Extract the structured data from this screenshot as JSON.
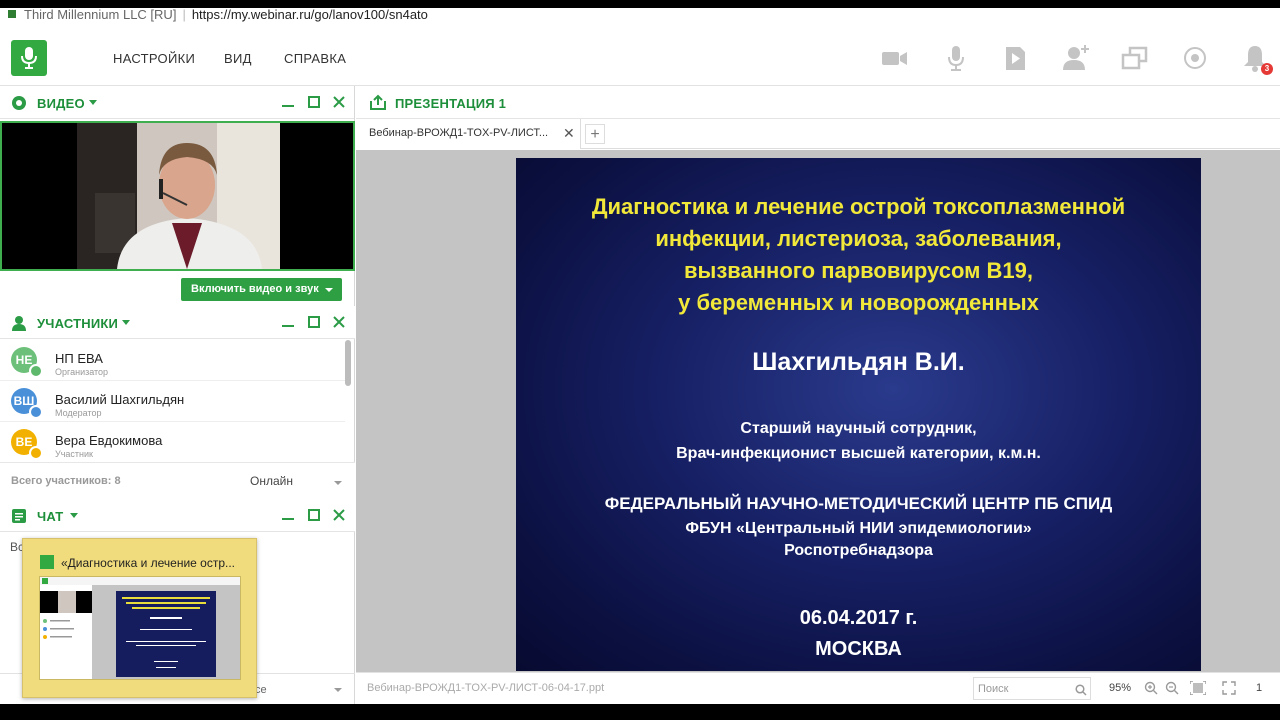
{
  "browser": {
    "site_name": "Third Millennium LLC [RU]",
    "url": "https://my.webinar.ru/go/lanov100/sn4ato"
  },
  "topbar": {
    "menu": [
      "НАСТРОЙКИ",
      "ВИД",
      "СПРАВКА"
    ],
    "notifications_count": "3",
    "icons": [
      "camera-icon",
      "microphone-icon",
      "play-icon",
      "add-user-icon",
      "screens-icon",
      "record-icon",
      "bell-icon"
    ]
  },
  "video_panel": {
    "title": "ВИДЕО",
    "enable_button": "Включить видео и звук"
  },
  "participants_panel": {
    "title": "УЧАСТНИКИ",
    "items": [
      {
        "initials": "НЕ",
        "name": "НП ЕВА",
        "role": "Организатор",
        "color": "#6cc07a",
        "role_color": "#5fb96d"
      },
      {
        "initials": "ВШ",
        "name": "Василий Шахгильдян",
        "role": "Модератор",
        "color": "#4a90d9",
        "role_color": "#4a90d9"
      },
      {
        "initials": "ВЕ",
        "name": "Вера Евдокимова",
        "role": "Участник",
        "color": "#f2b100",
        "role_color": "#f2b100"
      }
    ],
    "total_label": "Всего участников: 8",
    "status": "Онлайн"
  },
  "chat_panel": {
    "title": "ЧАТ",
    "first_line": "Все",
    "input_hint": "се"
  },
  "thumbnail": {
    "title": "«Диагностика и лечение остр..."
  },
  "presentation": {
    "title": "ПРЕЗЕНТАЦИЯ 1",
    "tab_label": "Вебинар-ВРОЖД1-TOX-PV-ЛИСТ...",
    "file_name": "Вебинар-ВРОЖД1-TOX-PV-ЛИСТ-06-04-17.ppt",
    "search_placeholder": "Поиск",
    "zoom": "95%",
    "page": "1"
  },
  "slide": {
    "title_lines": [
      "Диагностика и лечение острой токсоплазменной",
      "инфекции, листериоза, заболевания,",
      "вызванного парвовирусом В19,",
      "у беременных и новорожденных"
    ],
    "author": "Шахгильдян В.И.",
    "position_1": "Старший научный сотрудник,",
    "position_2": "Врач-инфекционист высшей категории, к.м.н.",
    "org_1": "ФЕДЕРАЛЬНЫЙ НАУЧНО-МЕТОДИЧЕСКИЙ ЦЕНТР  ПБ СПИД",
    "org_2": "ФБУН «Центральный НИИ эпидемиологии»",
    "org_3": "Роспотребнадзора",
    "date": "06.04.2017 г.",
    "city": "МОСКВА"
  }
}
